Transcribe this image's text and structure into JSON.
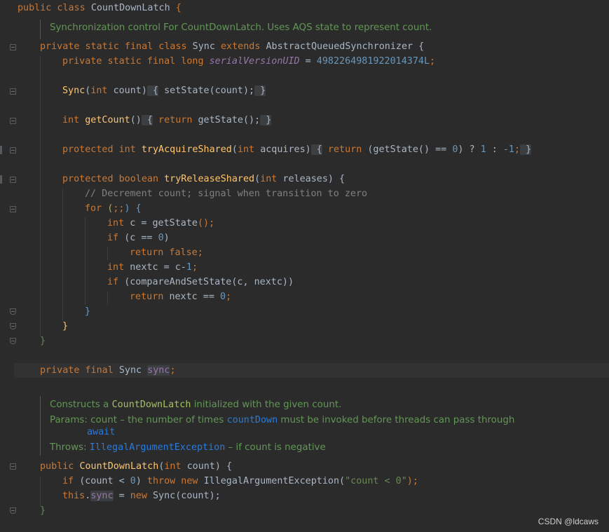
{
  "code": {
    "l1": {
      "k1": "public class ",
      "name": "CountDownLatch",
      "brace": " {"
    },
    "doc1": "Synchronization control For CountDownLatch. Uses AQS state to represent count.",
    "l3": {
      "k1": "private static final class ",
      "name": "Sync ",
      "k2": "extends ",
      "sup": "AbstractQueuedSynchronizer {"
    },
    "l4": {
      "k1": "private static final long ",
      "fld": "serialVersionUID",
      "eq": " = ",
      "num": "4982264981922014374L",
      ";": ";"
    },
    "l6": {
      "fn": "Sync",
      "p1": "(",
      "k": "int ",
      "t": "count)",
      "b1": " {",
      "body": " setState(count);",
      "b2": " }"
    },
    "l8": {
      "k": "int ",
      "fn": "getCount",
      "p": "()",
      "b1": " {",
      "k2": " return ",
      "t": "getState();",
      "b2": " }"
    },
    "l10": {
      "k": "protected int ",
      "fn": "tryAcquireShared",
      "p1": "(",
      "k2": "int ",
      "t": "acquires)",
      "b1": " {",
      "k3": " return ",
      "t2": "(getState() == ",
      "n0": "0",
      "t3": ") ? ",
      "n1": "1",
      "t4": " : ",
      "n2": "-1",
      "t5": ";",
      "b2": " }"
    },
    "l12": {
      "k": "protected boolean ",
      "fn": "tryReleaseShared",
      "p1": "(",
      "k2": "int ",
      "t": "releases) {"
    },
    "l13": "// Decrement count; signal when transition to zero",
    "l14": {
      "k": "for ",
      "t": "(",
      ";;": ";;",
      ")": ") {"
    },
    "l15": {
      "k": "int ",
      "t": "c = getState",
      ")": "();"
    },
    "l16": {
      "k": "if ",
      "t": "(c == ",
      "n": "0",
      ")": ")"
    },
    "l17": {
      "k": "return false",
      "s": ";"
    },
    "l18": {
      "k": "int ",
      "t": "nextc = c-",
      "n": "1",
      "s": ";"
    },
    "l19": {
      "k": "if ",
      "t": "(compareAndSetState(c, nextc))"
    },
    "l20": {
      "k": "return ",
      "t": "nextc == ",
      "n": "0",
      "s": ";"
    },
    "l21": "}",
    "l22": "}",
    "l23": "}",
    "l25": {
      "k": "private final ",
      "t": "Sync ",
      "fld": "sync",
      "s": ";"
    },
    "doc2": {
      "a": "Constructs a ",
      "code": "CountDownLatch",
      "b": " initialized with the given count."
    },
    "doc3": {
      "a": "Params: ",
      "b": "count – the number of times ",
      "link": "countDown",
      "c": " must be invoked before threads can pass through"
    },
    "doc3b": "await",
    "doc4": {
      "a": "Throws: ",
      "link": "IllegalArgumentException",
      "b": " – if count is negative"
    },
    "l30": {
      "k": "public ",
      "fn": "CountDownLatch",
      "p": "(",
      "k2": "int ",
      "t": "count) {"
    },
    "l31": {
      "k": "if ",
      "t": "(count < ",
      "n": "0",
      ")": ") ",
      "k2": "throw new ",
      "t2": "IllegalArgumentException(",
      "s": "\"count < 0\"",
      "e": ");"
    },
    "l32": {
      "k": "this",
      "d": ".",
      "fld": "sync",
      "t": " = ",
      "k2": "new ",
      "t2": "Sync(count);"
    },
    "l33": "}"
  },
  "watermark": "CSDN @ldcaws"
}
